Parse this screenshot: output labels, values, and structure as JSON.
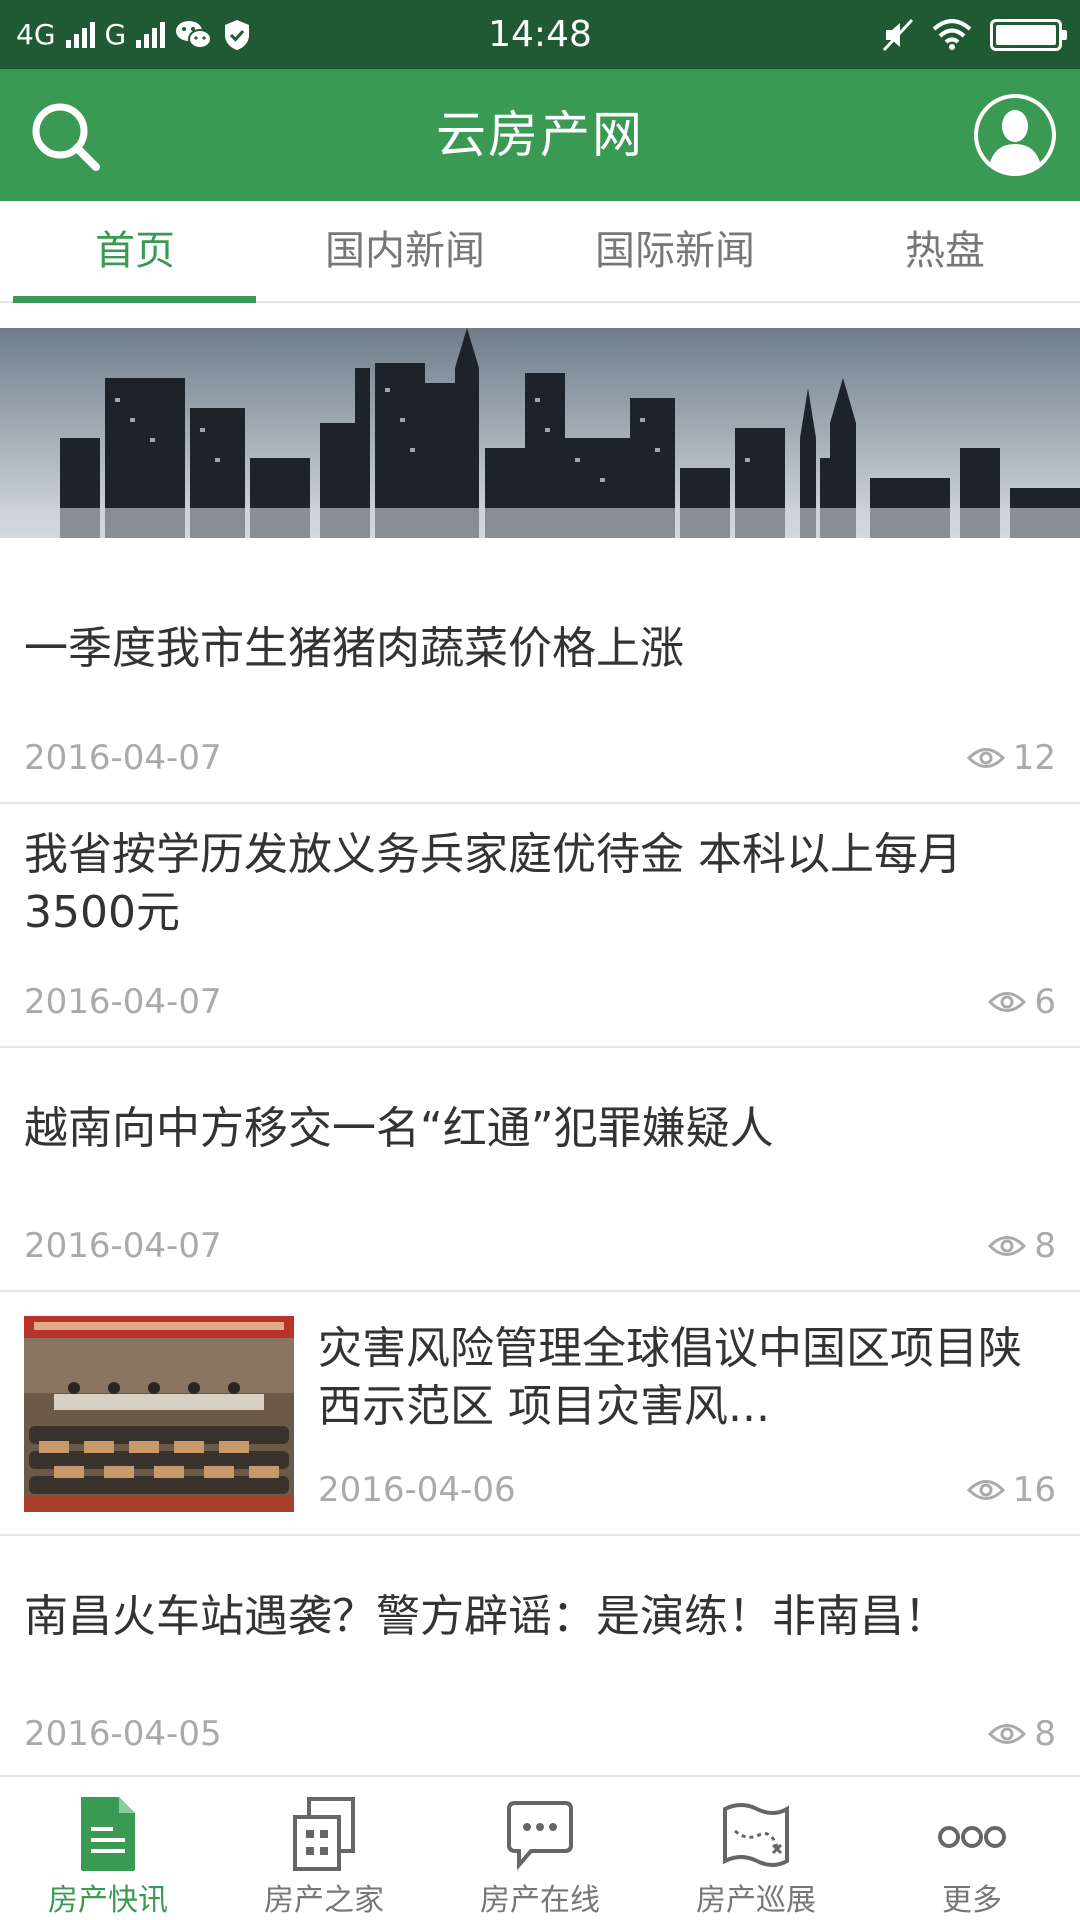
{
  "status_bar": {
    "network1": "4G",
    "network2": "G",
    "time": "14:48"
  },
  "header": {
    "title": "云房产网",
    "icons": {
      "search": "search-icon",
      "profile": "avatar-icon"
    }
  },
  "tabs": [
    {
      "label": "首页",
      "active": true
    },
    {
      "label": "国内新闻",
      "active": false
    },
    {
      "label": "国际新闻",
      "active": false
    },
    {
      "label": "热盘",
      "active": false
    }
  ],
  "news": [
    {
      "title": "一季度我市生猪猪肉蔬菜价格上涨",
      "date": "2016-04-07",
      "views": "12"
    },
    {
      "title": "我省按学历发放义务兵家庭优待金 本科以上每月3500元",
      "date": "2016-04-07",
      "views": "6"
    },
    {
      "title": "越南向中方移交一名“红通”犯罪嫌疑人",
      "date": "2016-04-07",
      "views": "8"
    },
    {
      "title": "灾害风险管理全球倡议中国区项目陕西示范区 项目灾害风...",
      "date": "2016-04-06",
      "views": "16"
    },
    {
      "title": "南昌火车站遇袭？警方辟谣：是演练！非南昌！",
      "date": "2016-04-05",
      "views": "8"
    }
  ],
  "bottom_nav": [
    {
      "label": "房产快讯",
      "icon": "document-icon",
      "active": true
    },
    {
      "label": "房产之家",
      "icon": "building-icon",
      "active": false
    },
    {
      "label": "房产在线",
      "icon": "chat-bubble-icon",
      "active": false
    },
    {
      "label": "房产巡展",
      "icon": "map-icon",
      "active": false
    },
    {
      "label": "更多",
      "icon": "more-dots-icon",
      "active": false
    }
  ],
  "colors": {
    "status_bar": "#1f5a35",
    "brand_green": "#3a9a53",
    "text_dark": "#333333",
    "text_muted": "#aaaaaa"
  }
}
